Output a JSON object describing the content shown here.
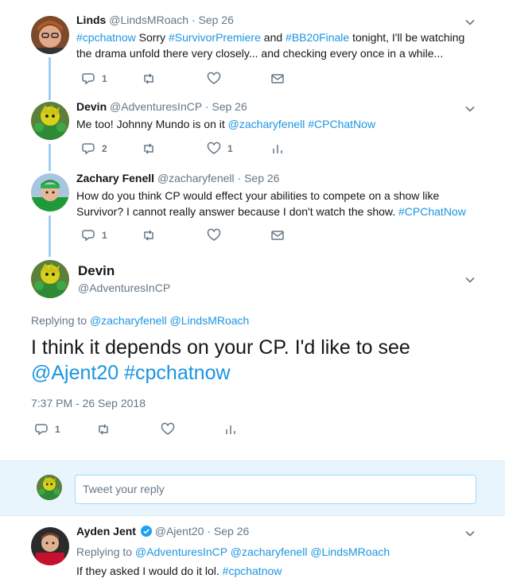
{
  "tweets": [
    {
      "name": "Linds",
      "handle": "@LindsMRoach",
      "date": "Sep 26",
      "text_parts": [
        {
          "t": "#cpchatnow",
          "link": true
        },
        {
          "t": " Sorry ",
          "link": false
        },
        {
          "t": "#SurvivorPremiere",
          "link": true
        },
        {
          "t": " and ",
          "link": false
        },
        {
          "t": "#BB20Finale",
          "link": true
        },
        {
          "t": "  tonight, I'll be watching the drama unfold there very closely... and checking every once in a while...",
          "link": false
        }
      ],
      "replies": "1",
      "retweets": "",
      "likes": ""
    },
    {
      "name": "Devin",
      "handle": "@AdventuresInCP",
      "date": "Sep 26",
      "text_parts": [
        {
          "t": "Me too! Johnny Mundo is on it ",
          "link": false
        },
        {
          "t": "@zacharyfenell",
          "link": true
        },
        {
          "t": " ",
          "link": false
        },
        {
          "t": "#CPChatNow",
          "link": true
        }
      ],
      "replies": "2",
      "retweets": "",
      "likes": "1"
    },
    {
      "name": "Zachary Fenell",
      "handle": "@zacharyfenell",
      "date": "Sep 26",
      "text_parts": [
        {
          "t": "How do you think CP would effect your abilities to compete on a show like Survivor? I cannot really answer because I don't watch the show. ",
          "link": false
        },
        {
          "t": "#CPChatNow",
          "link": true
        }
      ],
      "replies": "1",
      "retweets": "",
      "likes": ""
    }
  ],
  "main_tweet": {
    "name": "Devin",
    "handle": "@AdventuresInCP",
    "replying_label": "Replying to",
    "replying_to": [
      "@zacharyfenell",
      "@LindsMRoach"
    ],
    "text_plain": "I think it depends on your CP. I'd like to see",
    "text_links": [
      "@Ajent20",
      "#cpchatnow"
    ],
    "timestamp": "7:37 PM - 26 Sep 2018",
    "replies": "1"
  },
  "reply_box": {
    "placeholder": "Tweet your reply"
  },
  "reply_tweet": {
    "name": "Ayden Jent",
    "handle": "@Ajent20",
    "date": "Sep 26",
    "replying_label": "Replying to",
    "replying_to": [
      "@AdventuresInCP",
      "@zacharyfenell",
      "@LindsMRoach"
    ],
    "text_plain": "If they asked I would do it lol.",
    "text_link": "#cpchatnow"
  },
  "colors": {
    "link": "#1b95e0",
    "muted": "#657786",
    "thread_line": "#9bd1f5",
    "reply_bar_bg": "#e8f5fd"
  },
  "icons": [
    "reply-icon",
    "retweet-icon",
    "like-icon",
    "dm-icon",
    "analytics-icon",
    "caret-down-icon",
    "verified-icon"
  ]
}
